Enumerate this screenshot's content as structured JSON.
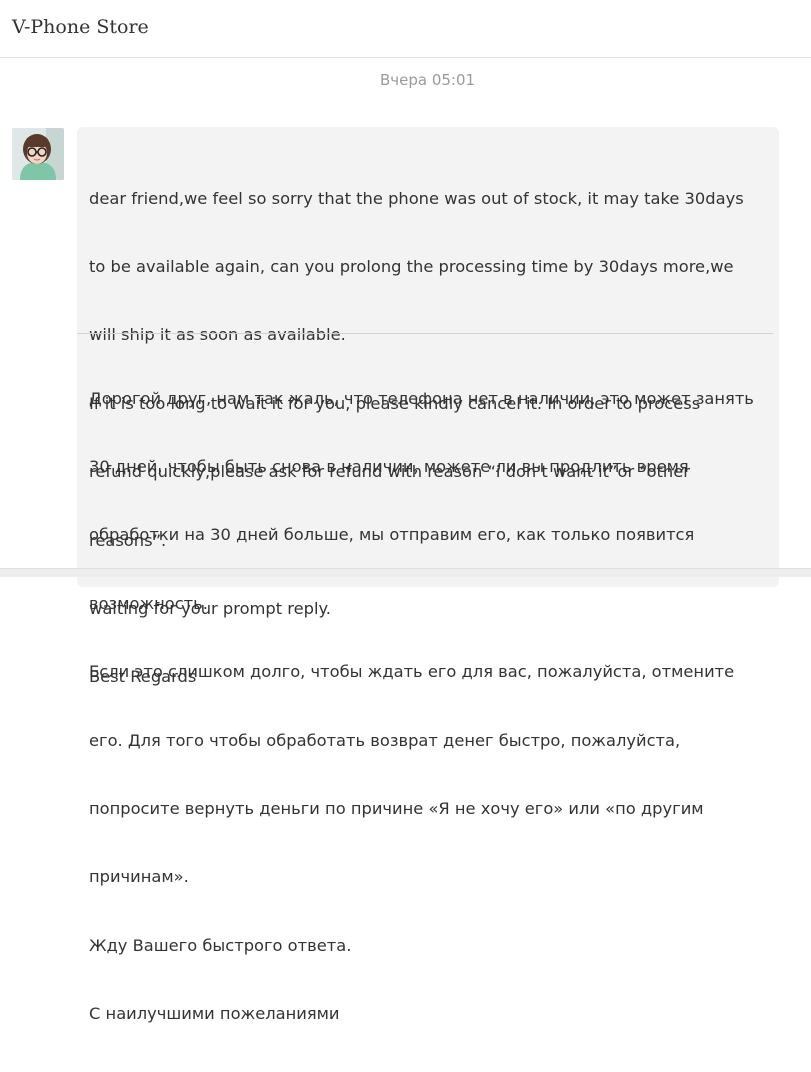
{
  "header": {
    "store_name": "V-Phone Store"
  },
  "conversation": {
    "timestamp": "Вчера 05:01",
    "message": {
      "original_lines": [
        "dear friend,we feel so sorry that the phone was out of stock, it may take 30days",
        "to be available again, can you prolong the processing time by 30days more,we",
        "will ship it as soon as available.",
        "If it is too long to wait it for you, please kindly cancel it. In order to process",
        "refund quickly,please ask for refund with reason “i don’t want it”or “other",
        "reasons”.",
        "waiting for your prompt reply.",
        "Best Regards"
      ],
      "translation_lines": [
        "Дорогой друг, нам так жаль, что телефона нет в наличии, это может занять",
        "30 дней, чтобы быть снова в наличии, можете ли вы продлить время",
        "обработки на 30 дней больше, мы отправим его, как только появится",
        "возможность.",
        "Если это слишком долго, чтобы ждать его для вас, пожалуйста, отмените",
        "его. Для того чтобы обработать возврат денег быстро, пожалуйста,",
        "попросите вернуть деньги по причине «Я не хочу его» или «по другим",
        "причинам».",
        "Жду Вашего быстрого ответа.",
        "С наилучшими пожеланиями"
      ]
    }
  },
  "colors": {
    "bubble_background": "#f3f3f3",
    "timestamp_text": "#9a9a9a",
    "body_text": "#333333",
    "divider": "#d3d3d3"
  }
}
